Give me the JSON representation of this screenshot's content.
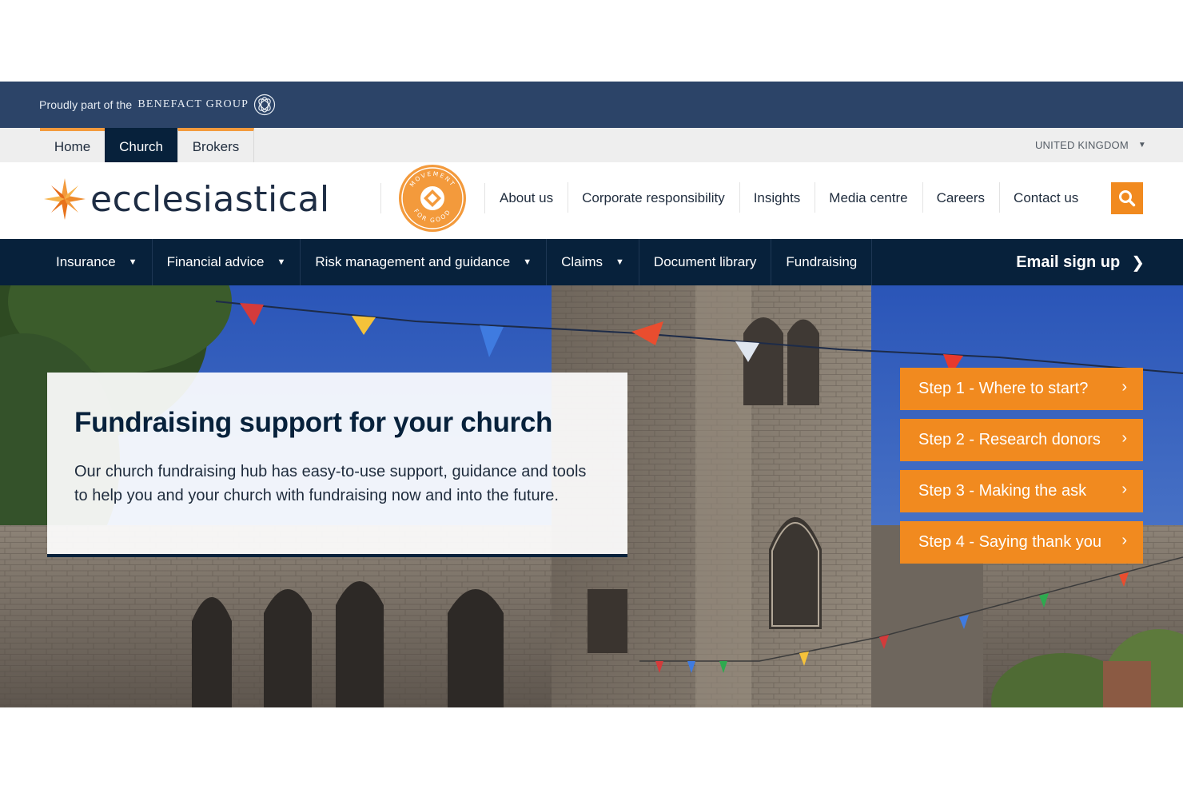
{
  "group_bar": {
    "text": "Proudly part of the",
    "brand": "BENEFACT GROUP",
    "icon": "benefact-knot-icon"
  },
  "site_tabs": [
    {
      "label": "Home",
      "active": false
    },
    {
      "label": "Church",
      "active": true
    },
    {
      "label": "Brokers",
      "active": false
    }
  ],
  "region": {
    "label": "UNITED KINGDOM",
    "icon": "caret-down-icon"
  },
  "header": {
    "logo_text": "ecclesiastical",
    "logo_icon": "orange-star-icon",
    "badge_text": "MOVEMENT FOR GOOD",
    "utility_links": [
      "About us",
      "Corporate responsibility",
      "Insights",
      "Media centre",
      "Careers",
      "Contact us"
    ],
    "search_icon": "search-icon"
  },
  "main_nav": {
    "items": [
      {
        "label": "Insurance",
        "dropdown": true
      },
      {
        "label": "Financial advice",
        "dropdown": true
      },
      {
        "label": "Risk management and guidance",
        "dropdown": true
      },
      {
        "label": "Claims",
        "dropdown": true
      },
      {
        "label": "Document library",
        "dropdown": false
      },
      {
        "label": "Fundraising",
        "dropdown": false
      }
    ],
    "email_signup": "Email sign up"
  },
  "hero": {
    "title": "Fundraising support for your church",
    "body": "Our church fundraising hub has easy-to-use support, guidance and tools to help you and your church with fundraising now and into the future.",
    "steps": [
      "Step 1 - Where to start?",
      "Step 2 - Research donors",
      "Step 3 - Making the ask",
      "Step 4 - Saying thank you"
    ]
  },
  "colors": {
    "navy": "#07213b",
    "group_bar": "#2c4468",
    "accent_orange": "#f18a1f",
    "tab_highlight": "#f39a3c"
  }
}
